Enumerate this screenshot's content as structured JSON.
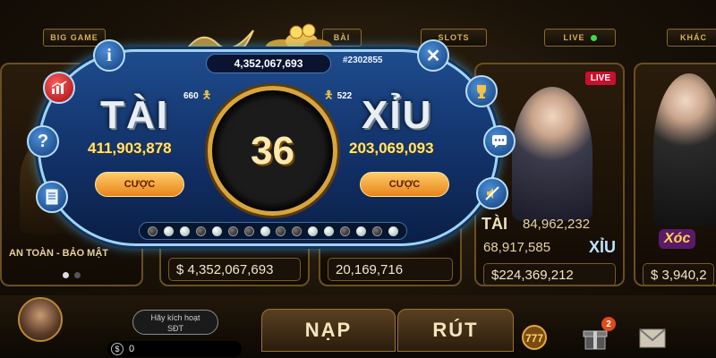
{
  "top_tabs": [
    {
      "label": "BIG GAME"
    },
    {
      "label": "BÀI"
    },
    {
      "label": "SLOTS"
    },
    {
      "label": "LIVE"
    },
    {
      "label": "KHÁC"
    }
  ],
  "cards": {
    "left_caption": "AN TOÀN - BẢO MẬT",
    "card2_amount": "$ 4,352,067,693",
    "card3_amount": "20,169,716",
    "card4": {
      "live_badge": "LIVE",
      "tai_label": "TÀI",
      "tai_amount": "84,962,232",
      "xiu_amount": "68,917,585",
      "xiu_label": "XỈU",
      "total": "$224,369,212"
    },
    "card5": {
      "logo_text": "Xóc",
      "amount": "$ 3,940,2"
    }
  },
  "modal": {
    "jackpot": "4,352,067,693",
    "session": "#2302855",
    "tai": {
      "word": "TÀI",
      "players": "660",
      "total": "411,903,878",
      "bet_label": "CƯỢC"
    },
    "xiu": {
      "word": "XỈU",
      "players": "522",
      "total": "203,069,093",
      "bet_label": "CƯỢC"
    },
    "timer": "36",
    "history": [
      "b",
      "w",
      "w",
      "b",
      "w",
      "b",
      "b",
      "w",
      "b",
      "b",
      "w",
      "w",
      "b",
      "w",
      "b",
      "w"
    ],
    "buttons": {
      "info": "i",
      "help": "?",
      "close": "✕"
    }
  },
  "bottom": {
    "activate_line1": "Hãy kích hoạt",
    "activate_line2": "SĐT",
    "balance": "0",
    "nap": "NẠP",
    "rut": "RÚT",
    "gift_badge": "2"
  },
  "colors": {
    "gold": "#d9a43a",
    "modal_blue": "#123168",
    "total_yellow": "#ffe67a",
    "bet_orange": "#e88417"
  }
}
